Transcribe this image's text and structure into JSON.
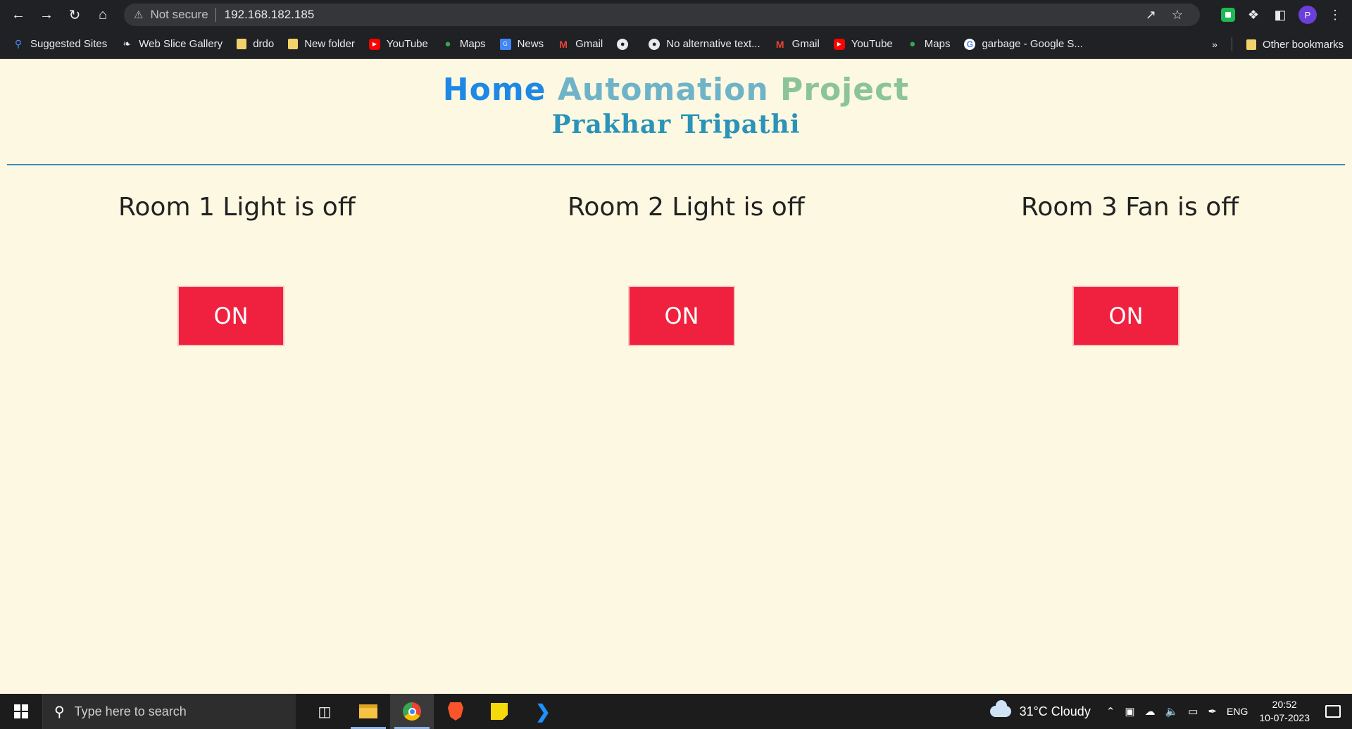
{
  "browser": {
    "security_label": "Not secure",
    "url": "192.168.182.185",
    "profile_initial": "P"
  },
  "bookmarks": [
    {
      "label": "Suggested Sites",
      "icon": "search-icon"
    },
    {
      "label": "Web Slice Gallery",
      "icon": "web-slice-icon"
    },
    {
      "label": "drdo",
      "icon": "folder-icon"
    },
    {
      "label": "New folder",
      "icon": "folder-icon"
    },
    {
      "label": "YouTube",
      "icon": "youtube-icon"
    },
    {
      "label": "Maps",
      "icon": "maps-icon"
    },
    {
      "label": "News",
      "icon": "news-icon"
    },
    {
      "label": "Gmail",
      "icon": "gmail-icon"
    },
    {
      "label": "",
      "icon": "globe-icon"
    },
    {
      "label": "No alternative text...",
      "icon": "globe-icon"
    },
    {
      "label": "Gmail",
      "icon": "gmail-icon"
    },
    {
      "label": "YouTube",
      "icon": "youtube-icon"
    },
    {
      "label": "Maps",
      "icon": "maps-icon"
    },
    {
      "label": "garbage - Google S...",
      "icon": "google-icon"
    }
  ],
  "other_bookmarks": "Other bookmarks",
  "page": {
    "title_part1": "Home ",
    "title_part2": "Automation ",
    "title_part3": "Project",
    "subtitle": "Prakhar Tripathi",
    "rooms": [
      {
        "label": "Room 1 Light is off",
        "button": "ON"
      },
      {
        "label": "Room 2 Light is off",
        "button": "ON"
      },
      {
        "label": "Room 3 Fan is off",
        "button": "ON"
      }
    ],
    "button_color": "#f0213f"
  },
  "taskbar": {
    "search_placeholder": "Type here to search",
    "weather": "31°C  Cloudy",
    "language": "ENG",
    "time": "20:52",
    "date": "10-07-2023"
  }
}
